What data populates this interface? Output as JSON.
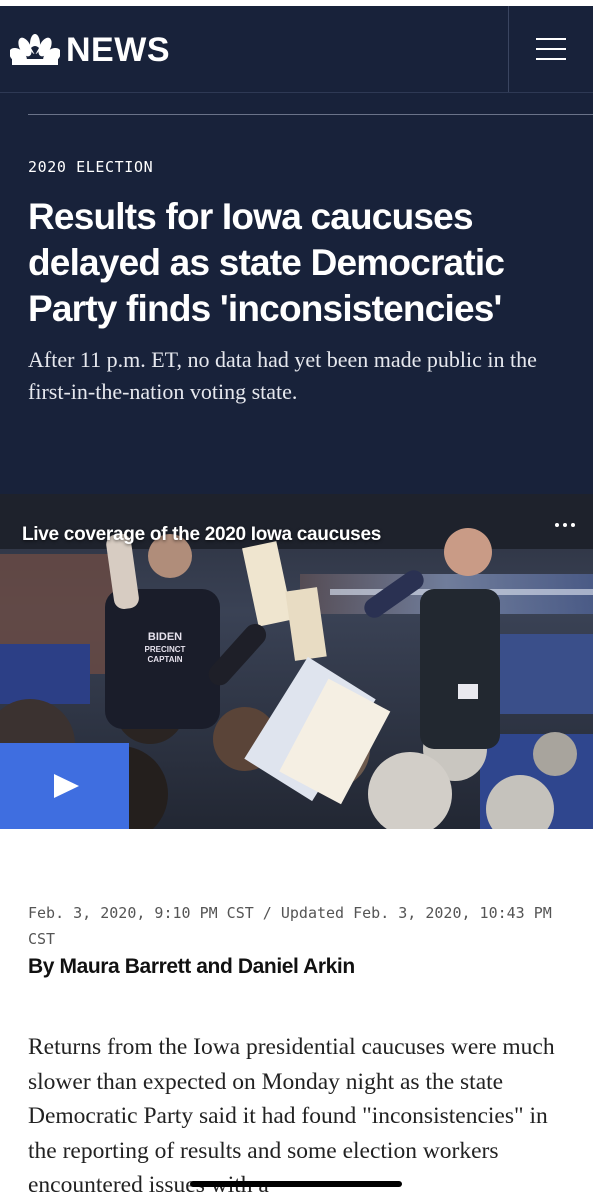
{
  "brand": {
    "logo_text": "NEWS",
    "bg_color": "#18223a",
    "accent_blue": "#3f6ee0"
  },
  "navbar": {
    "menu_icon": "hamburger-menu-icon",
    "logo_icon": "nbc-peacock-icon"
  },
  "article": {
    "section": "2020 ELECTION",
    "headline": "Results for Iowa caucuses delayed as state Democratic Party finds 'inconsistencies'",
    "dek": "After 11 p.m. ET, no data had yet been made public in the first-in-the-nation voting state.",
    "timestamp": "Feb. 3, 2020, 9:10 PM CST / Updated Feb. 3, 2020, 10:43 PM CST",
    "byline_prefix": "By ",
    "author_1": "Maura Barrett",
    "byline_and": " and ",
    "author_2": "Daniel Arkin",
    "body": "Returns from the Iowa presidential caucuses were much slower than expected on Monday night as the state Democratic Party said it had found \"inconsistencies\" in the reporting of results and some election workers encountered issues with a"
  },
  "video": {
    "title": "Live coverage of the 2020 Iowa caucuses",
    "more_icon": "more-options-icon",
    "play_icon": "play-icon",
    "sign_text_1": "BIDEN",
    "sign_text_2": "PRECINCT",
    "sign_text_3": "CAPTAIN"
  }
}
